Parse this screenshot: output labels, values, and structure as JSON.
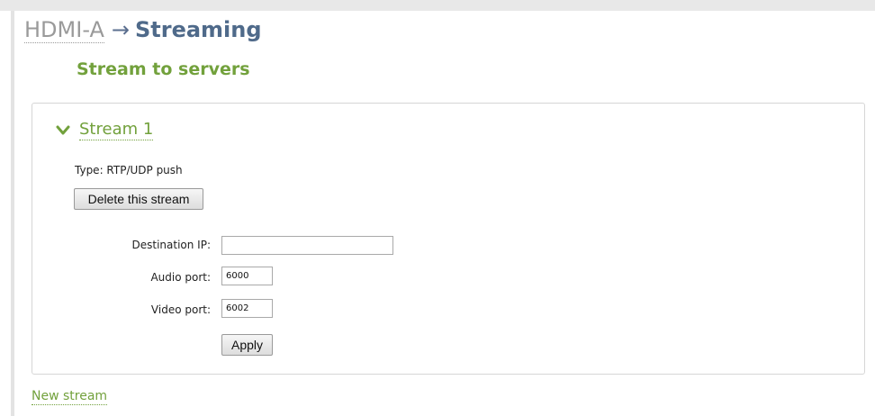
{
  "breadcrumb": {
    "parent": "HDMI-A",
    "separator": "→",
    "current": "Streaming"
  },
  "section": {
    "title": "Stream to servers"
  },
  "stream": {
    "name": "Stream 1",
    "expanded": true,
    "type_line": "Type: RTP/UDP push",
    "delete_label": "Delete this stream",
    "fields": {
      "destination_ip": {
        "label": "Destination IP:",
        "value": ""
      },
      "audio_port": {
        "label": "Audio port:",
        "value": "6000"
      },
      "video_port": {
        "label": "Video port:",
        "value": "6002"
      }
    },
    "apply_label": "Apply"
  },
  "new_stream_label": "New stream",
  "colors": {
    "accent_green": "#72a13c",
    "title_blue": "#4f6a8a",
    "breadcrumb_gray": "#9a9a9a"
  }
}
